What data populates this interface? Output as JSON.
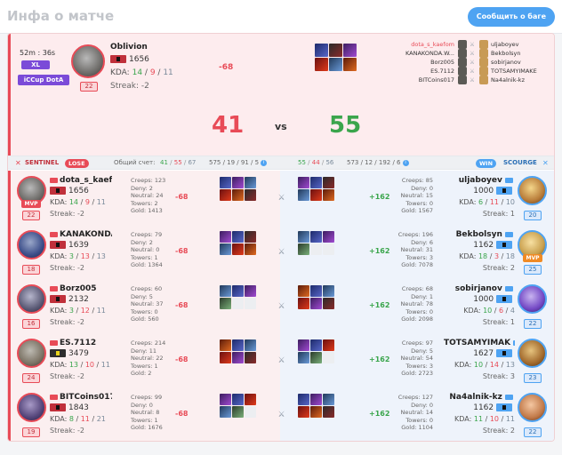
{
  "page": {
    "title": "Инфа о матче",
    "report_button": "Сообщить о баге"
  },
  "summary": {
    "duration": "52m : 36s",
    "lobby_badge": "XL",
    "league_badge": "iCCup DotA",
    "player": {
      "name": "Oblivion",
      "mmr": "1656",
      "kda_label": "KDA:",
      "kills": "14",
      "deaths": "9",
      "assists": "11",
      "streak": "Streak: -2",
      "level": "22",
      "diff": "-68"
    },
    "score_sentinel": "41",
    "vs": "vs",
    "score_scourge": "55",
    "sentinel_names": [
      "dota_s_kaefom",
      "KANAKONDA.W...",
      "Borz005",
      "ES.7112",
      "BITCoins017"
    ],
    "scourge_names": [
      "uljaboyev",
      "Bekbolsyn",
      "sobirjanov",
      "TOTSAMYIMAKE",
      "Na4alnik-kz"
    ]
  },
  "teambar": {
    "sentinel_label": "SENTINEL",
    "sentinel_result": "LOSE",
    "general_label": "Общий счет:",
    "s_kills": "41",
    "s_deaths": "55",
    "s_assists": "67",
    "s_extra": "575 / 19 / 91 / 5",
    "c_kills": "55",
    "c_deaths": "44",
    "c_assists": "56",
    "c_extra": "573 / 12 / 192 / 6",
    "scourge_result": "WIN",
    "scourge_label": "SCOURGE"
  },
  "rows": [
    {
      "left": {
        "name": "dota_s_kaefc",
        "mmr": "1656",
        "kills": "14",
        "deaths": "9",
        "assists": "11",
        "streak": "Streak: -2",
        "level": "22",
        "mvp": "MVP",
        "stats": [
          "Creeps: 123",
          "Deny: 2",
          "Neutral: 24",
          "Towers: 2",
          "Gold: 1413"
        ],
        "diff": "-68"
      },
      "right": {
        "name": "uljaboyev",
        "mmr": "1000",
        "kills": "6",
        "deaths": "11",
        "assists": "10",
        "streak": "Streak: 1",
        "level": "20",
        "mvp": "",
        "stats": [
          "Creeps: 85",
          "Deny: 0",
          "Neutral: 15",
          "Towers: 0",
          "Gold: 1567"
        ],
        "diff": "+162"
      }
    },
    {
      "left": {
        "name": "KANAKONDA.W",
        "mmr": "1639",
        "kills": "3",
        "deaths": "13",
        "assists": "13",
        "streak": "Streak: -2",
        "level": "18",
        "mvp": "",
        "stats": [
          "Creeps: 79",
          "Deny: 2",
          "Neutral: 0",
          "Towers: 1",
          "Gold: 1364"
        ],
        "diff": "-68"
      },
      "right": {
        "name": "Bekbolsyn",
        "mmr": "1162",
        "kills": "18",
        "deaths": "3",
        "assists": "18",
        "streak": "Streak: 2",
        "level": "25",
        "mvp": "MVP",
        "stats": [
          "Creeps: 196",
          "Deny: 6",
          "Neutral: 31",
          "Towers: 3",
          "Gold: 7078"
        ],
        "diff": "+162"
      }
    },
    {
      "left": {
        "name": "Borz005",
        "mmr": "2132",
        "kills": "3",
        "deaths": "12",
        "assists": "11",
        "streak": "Streak: -2",
        "level": "16",
        "mvp": "",
        "stats": [
          "Creeps: 60",
          "Deny: 5",
          "Neutral: 37",
          "Towers: 0",
          "Gold: 560"
        ],
        "diff": "-68"
      },
      "right": {
        "name": "sobirjanov",
        "mmr": "1000",
        "kills": "10",
        "deaths": "6",
        "assists": "4",
        "streak": "Streak: 1",
        "level": "22",
        "mvp": "",
        "stats": [
          "Creeps: 68",
          "Deny: 1",
          "Neutral: 78",
          "Towers: 0",
          "Gold: 2098"
        ],
        "diff": "+162"
      }
    },
    {
      "left": {
        "name": "ES.7112",
        "mmr": "3479",
        "kills": "13",
        "deaths": "10",
        "assists": "11",
        "streak": "Streak: -2",
        "level": "24",
        "mvp": "",
        "stats": [
          "Creeps: 214",
          "Deny: 11",
          "Neutral: 22",
          "Towers: 1",
          "Gold: 2"
        ],
        "diff": "-68"
      },
      "right": {
        "name": "TOTSAMYIMAK",
        "mmr": "1627",
        "kills": "10",
        "deaths": "14",
        "assists": "13",
        "streak": "Streak: 3",
        "level": "23",
        "mvp": "",
        "stats": [
          "Creeps: 97",
          "Deny: 5",
          "Neutral: 54",
          "Towers: 3",
          "Gold: 2723"
        ],
        "diff": "+162"
      }
    },
    {
      "left": {
        "name": "BITCoins017",
        "mmr": "1843",
        "kills": "8",
        "deaths": "11",
        "assists": "21",
        "streak": "Streak: -2",
        "level": "19",
        "mvp": "",
        "stats": [
          "Creeps: 99",
          "Deny: 0",
          "Neutral: 8",
          "Towers: 1",
          "Gold: 1676"
        ],
        "diff": "-68"
      },
      "right": {
        "name": "Na4alnik-kz",
        "mmr": "1162",
        "kills": "11",
        "deaths": "10",
        "assists": "11",
        "streak": "Streak: 2",
        "level": "22",
        "mvp": "",
        "stats": [
          "Creeps: 127",
          "Deny: 0",
          "Neutral: 14",
          "Towers: 0",
          "Gold: 1104"
        ],
        "diff": "+162"
      }
    }
  ],
  "kda_label": "KDA:",
  "colors": {
    "accent": "#4ea3f2",
    "lose": "#e84b57",
    "win": "#3aa54c",
    "badge": "#7b4bd8"
  }
}
